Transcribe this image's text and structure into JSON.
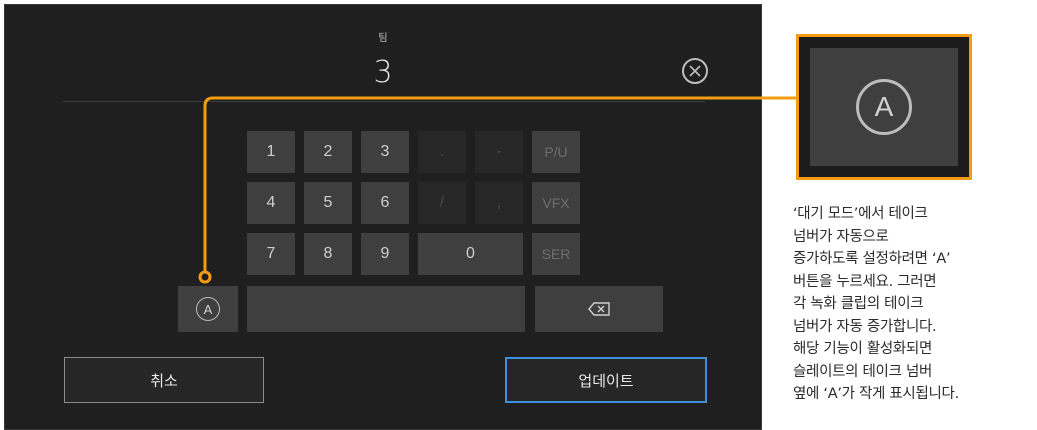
{
  "dialog": {
    "field_title": "팀",
    "field_value": "3",
    "keypad": {
      "rows": [
        [
          "1",
          "2",
          "3",
          ".",
          "-",
          "P/U"
        ],
        [
          "4",
          "5",
          "6",
          "/",
          ",",
          "VFX"
        ],
        [
          "7",
          "8",
          "9",
          "0",
          "SER"
        ]
      ]
    },
    "auto_label": "A",
    "cancel_label": "취소",
    "update_label": "업데이트"
  },
  "zoom": {
    "auto_label": "A"
  },
  "caption_lines": [
    "‘대기 모드’에서 테이크",
    "넘버가 자동으로",
    "증가하도록 설정하려면 ‘A’",
    "버튼을 누르세요. 그러면",
    "각 녹화 클립의 테이크",
    "넘버가 자동 증가합니다.",
    "해당 기능이 활성화되면",
    "슬레이트의 테이크 넘버",
    "옆에 ‘A’가 작게 표시됩니다."
  ],
  "colors": {
    "panel": "#1f1f1f",
    "key": "#3f3f3f",
    "accent_orange": "#f39c12",
    "update_border": "#3d8fd8"
  },
  "icons": [
    "clear-icon",
    "auto-take-icon",
    "backspace-icon"
  ]
}
